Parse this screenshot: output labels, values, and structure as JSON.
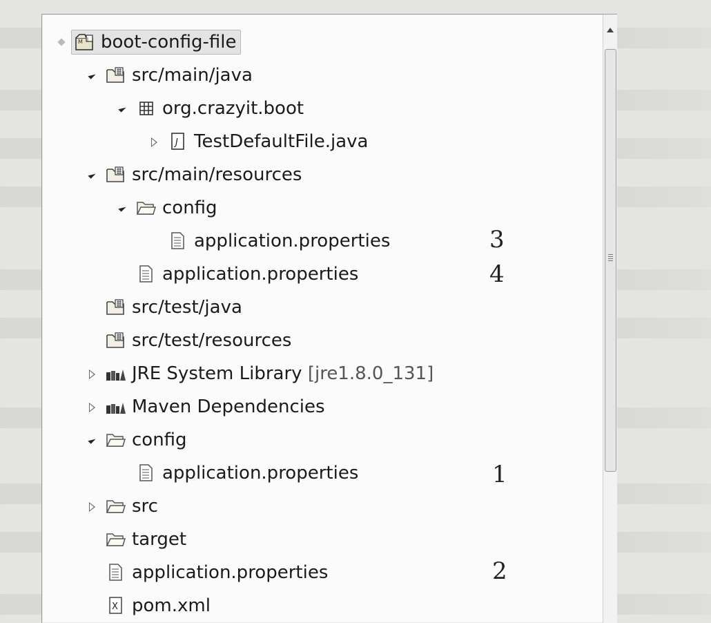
{
  "tree": {
    "items": [
      {
        "label": "boot-config-file",
        "icon": "maven-project-icon",
        "twisty": "gray"
      },
      {
        "label": "src/main/java",
        "icon": "source-folder-icon",
        "twisty": "open"
      },
      {
        "label": "org.crazyit.boot",
        "icon": "package-icon",
        "twisty": "open"
      },
      {
        "label": "TestDefaultFile.java",
        "icon": "java-file-icon",
        "twisty": "closed"
      },
      {
        "label": "src/main/resources",
        "icon": "source-folder-icon",
        "twisty": "open"
      },
      {
        "label": "config",
        "icon": "folder-icon",
        "twisty": "open"
      },
      {
        "label": "application.properties",
        "icon": "text-file-icon",
        "twisty": "none"
      },
      {
        "label": "application.properties",
        "icon": "text-file-icon",
        "twisty": "none"
      },
      {
        "label": "src/test/java",
        "icon": "source-folder-icon",
        "twisty": "none"
      },
      {
        "label": "src/test/resources",
        "icon": "source-folder-icon",
        "twisty": "none"
      },
      {
        "label": "JRE System Library",
        "suffix": "[jre1.8.0_131]",
        "icon": "library-icon",
        "twisty": "closed"
      },
      {
        "label": "Maven Dependencies",
        "icon": "library-icon",
        "twisty": "closed"
      },
      {
        "label": "config",
        "icon": "folder-icon",
        "twisty": "open"
      },
      {
        "label": "application.properties",
        "icon": "text-file-icon",
        "twisty": "none"
      },
      {
        "label": "src",
        "icon": "folder-icon",
        "twisty": "closed"
      },
      {
        "label": "target",
        "icon": "folder-icon",
        "twisty": "none"
      },
      {
        "label": "application.properties",
        "icon": "text-file-icon",
        "twisty": "none"
      },
      {
        "label": "pom.xml",
        "icon": "xml-file-icon",
        "twisty": "none"
      }
    ]
  },
  "annotations": [
    "3",
    "4",
    "1",
    "2"
  ]
}
